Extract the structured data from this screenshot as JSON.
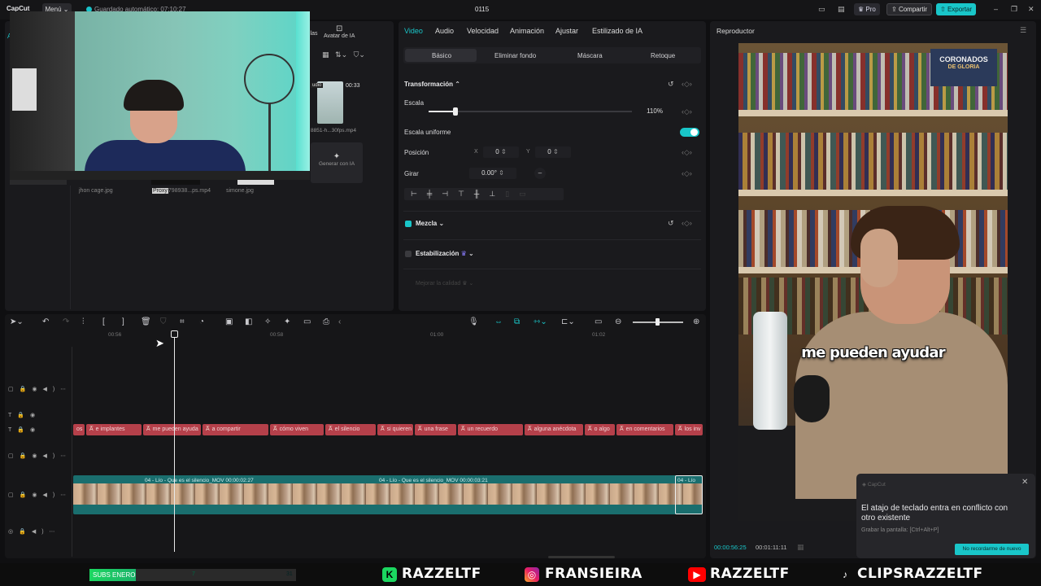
{
  "app": {
    "logo": "CapCut",
    "menu_label": "Menú",
    "autosave": "Guardado automático: 07:10:27",
    "project_title": "0115",
    "pro_label": "Pro",
    "share_label": "Compartir",
    "export_label": "Exportar"
  },
  "media": {
    "tab_partial": "llas",
    "avatar_tab": "Avatar de IA",
    "left_tab_initial": "A",
    "video_tag": "udio",
    "video_duration": "00:33",
    "video_name": "8851-h...30fps.mp4",
    "generate_ai": "Generar con IA",
    "items": [
      {
        "name": "jhon cage.jpg"
      },
      {
        "proxy": "Proxy",
        "name": "798938...ps.mp4"
      },
      {
        "name": "simone.jpg"
      }
    ]
  },
  "props": {
    "tabs": [
      "Video",
      "Audio",
      "Velocidad",
      "Animación",
      "Ajustar",
      "Estilizado de IA"
    ],
    "subtabs": [
      "Básico",
      "Eliminar fondo",
      "Máscara",
      "Retoque"
    ],
    "transform_title": "Transformación",
    "scale_label": "Escala",
    "scale_value": "110%",
    "scale_fraction": 0.13,
    "uniform_label": "Escala uniforme",
    "uniform_on": true,
    "position_label": "Posición",
    "pos_x_label": "X",
    "pos_x": "0",
    "pos_y_label": "Y",
    "pos_y": "0",
    "rotate_label": "Girar",
    "rotate_value": "0.00°",
    "blend_label": "Mezcla",
    "blend_checked": true,
    "stabilize_label": "Estabilización",
    "stabilize_checked": false,
    "enhance_label": "Mejorar la calidad"
  },
  "player": {
    "title": "Reproductor",
    "subtitle": "me pueden ayudar",
    "badge_line1": "CORONADOS",
    "badge_line2": "DE GLORIA",
    "current_time": "00:00:56:25",
    "total_time": "00:01:11:11"
  },
  "toast": {
    "app": "CapCut",
    "message": "El atajo de teclado entra en conflicto con otro existente",
    "hint": "Grabar la pantalla: [Ctrl+Alt+P]",
    "button": "No recordarme de nuevo"
  },
  "timeline": {
    "ruler": [
      "00:56",
      "00:58",
      "01:00",
      "01:02"
    ],
    "captions": [
      {
        "text": "os"
      },
      {
        "text": "e implantes"
      },
      {
        "text": "me pueden ayuda"
      },
      {
        "text": "a compartir"
      },
      {
        "text": "cómo viven"
      },
      {
        "text": "el silencio"
      },
      {
        "text": "si quieren"
      },
      {
        "text": "una frase"
      },
      {
        "text": "un recuerdo"
      },
      {
        "text": "alguna anécdota"
      },
      {
        "text": "o algo"
      },
      {
        "text": "en comentarios"
      },
      {
        "text": "los inv"
      }
    ],
    "caption_tag": "A̅",
    "video_labels": [
      "04 - Lío - Que es el silencio_MOV  00:00:02:27",
      "04 - Lío - Que es el silencio_MOV  00:00:03:21",
      "04 - Lío"
    ]
  },
  "overlay": {
    "subs_label": "SUBS ENERO",
    "subs_current": "7",
    "subs_goal": "31",
    "socials": [
      {
        "icon": "kick-icon",
        "handle": "RAZZELTF"
      },
      {
        "icon": "instagram-icon",
        "handle": "FRANSIEIRA"
      },
      {
        "icon": "youtube-icon",
        "handle": "RAZZELTF"
      },
      {
        "icon": "tiktok-icon",
        "handle": "CLIPSRAZZELTF"
      }
    ]
  },
  "colors": {
    "accent": "#19c6c9",
    "caption_track": "#b5404a",
    "video_track": "#1a6e6e",
    "subs_green": "#1bd760"
  }
}
